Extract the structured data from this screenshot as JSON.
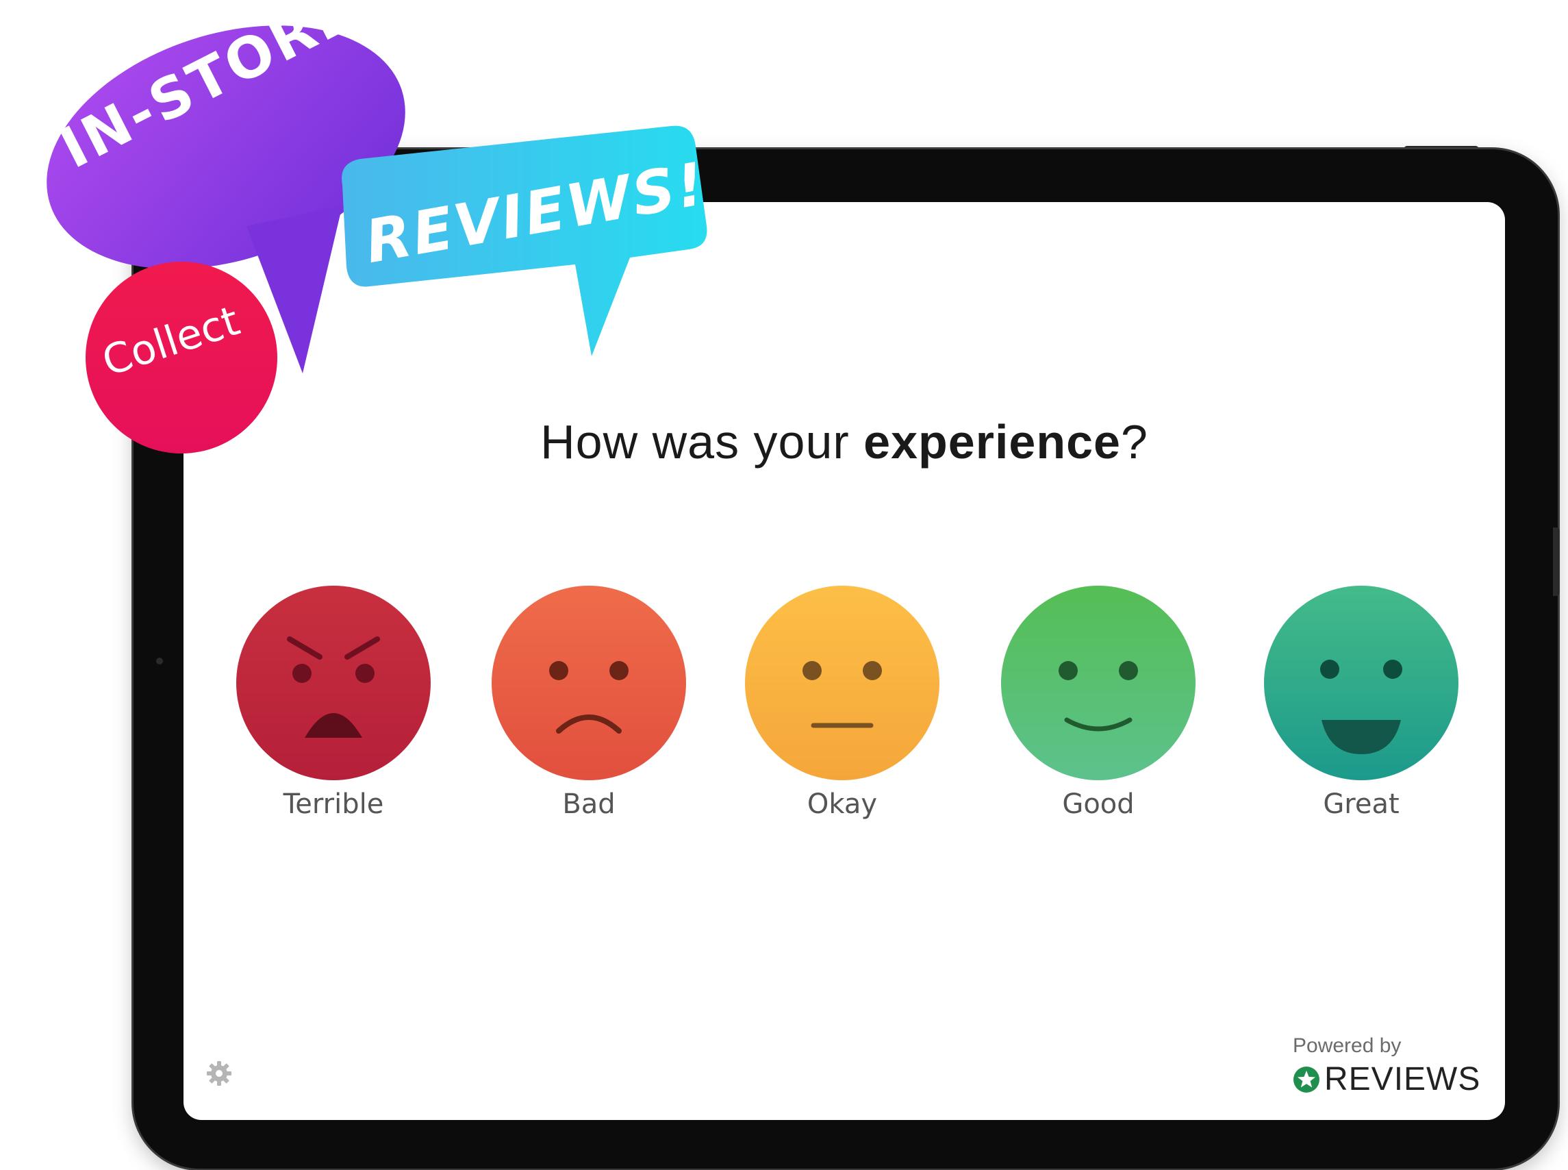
{
  "survey": {
    "question_plain": "How was your ",
    "question_bold": "experience",
    "question_end": "?",
    "options": [
      {
        "label": "Terrible",
        "icon": "angry-face-icon",
        "color_top": "#c42a3f",
        "color_bottom": "#b8213a"
      },
      {
        "label": "Bad",
        "icon": "sad-face-icon",
        "color_top": "#ef6a47",
        "color_bottom": "#e6523f"
      },
      {
        "label": "Okay",
        "icon": "neutral-face-icon",
        "color_top": "#fcbc45",
        "color_bottom": "#f6a93a"
      },
      {
        "label": "Good",
        "icon": "smile-face-icon",
        "color_top": "#54bd55",
        "color_bottom": "#5cc28c"
      },
      {
        "label": "Great",
        "icon": "grin-face-icon",
        "color_top": "#41b98a",
        "color_bottom": "#1f9d8c"
      }
    ]
  },
  "footer": {
    "powered_by": "Powered by",
    "brand": "REVIEWS"
  },
  "stickers": {
    "instore": "IN-STORE",
    "collect": "Collect",
    "reviews": "REVIEWS!"
  },
  "colors": {
    "purple": "#8e3fe0",
    "pink": "#ee1452",
    "cyan": "#2fd3ee",
    "brand_green": "#1f8f4e"
  }
}
